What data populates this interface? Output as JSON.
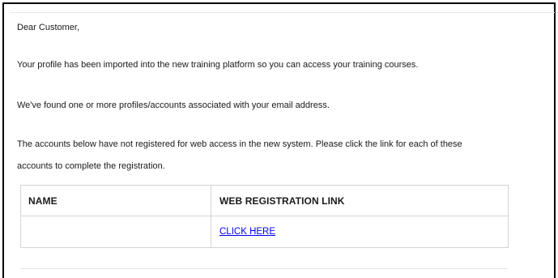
{
  "email": {
    "greeting": "Dear Customer,",
    "paragraph_1": "Your profile has been imported into the new training platform so you can access your training courses.",
    "paragraph_2": "We've found one or more profiles/accounts associated with your email address.",
    "paragraph_3_line_1": "The accounts below have not registered for web access in the new system. Please click the link for each of these",
    "paragraph_3_line_2": "accounts to complete the registration."
  },
  "accounts_table": {
    "headers": [
      "NAME",
      "WEB REGISTRATION LINK"
    ],
    "rows": [
      {
        "name": "",
        "link_label": "CLICK HERE"
      }
    ]
  },
  "colors": {
    "link": "#0000ee",
    "border": "#d4d4d4",
    "frame": "#000000"
  }
}
